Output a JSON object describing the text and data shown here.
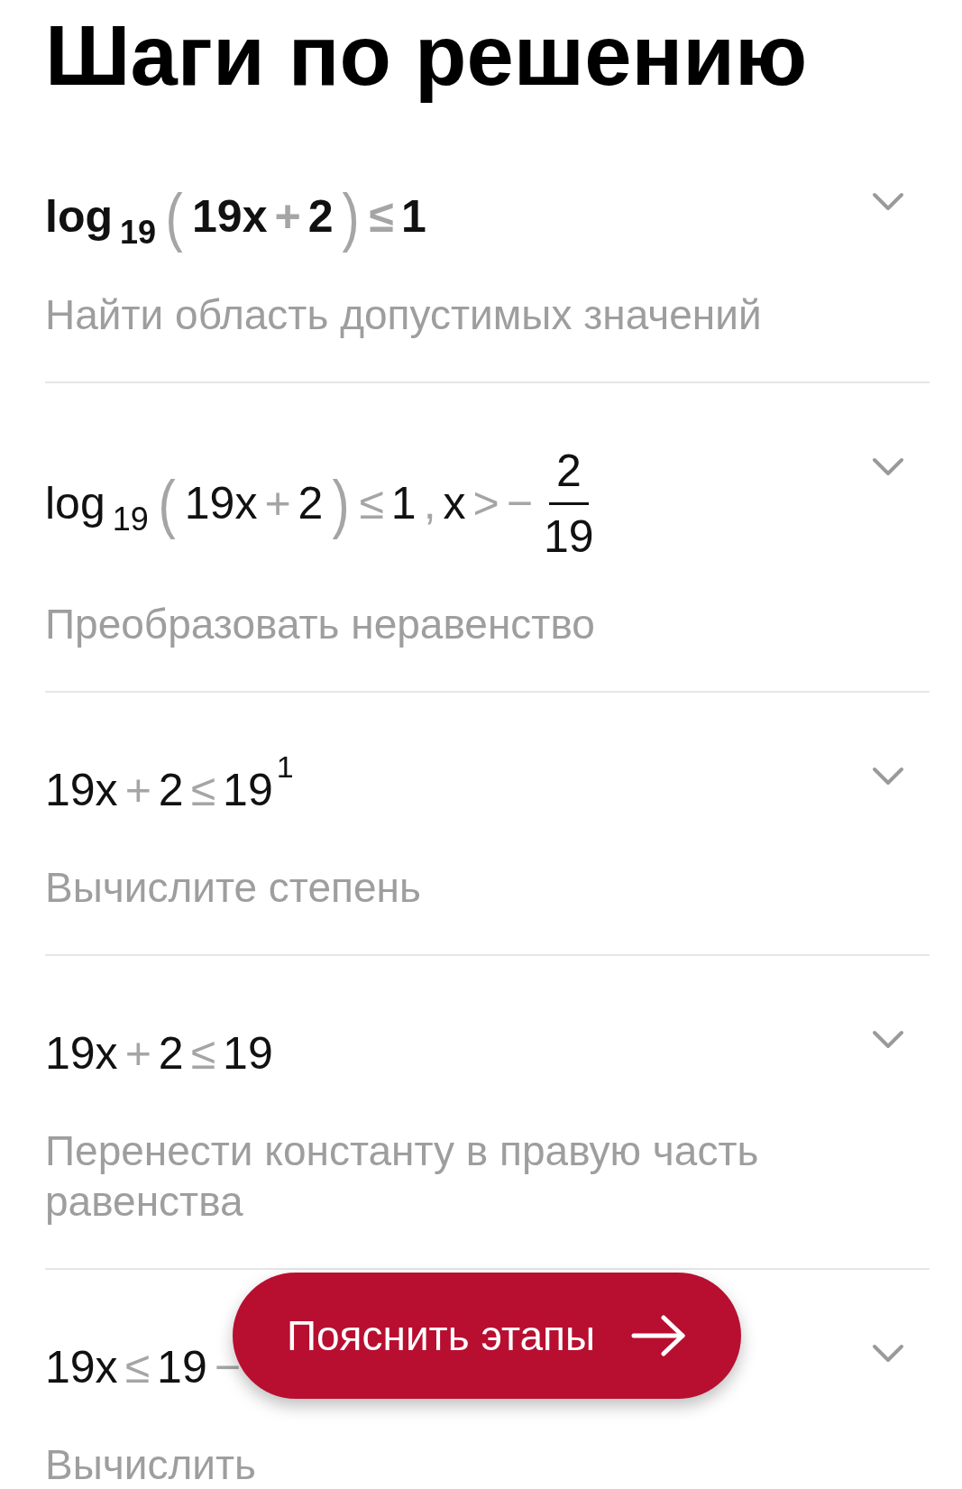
{
  "title": "Шаги по решению",
  "steps": [
    {
      "bold": true,
      "formula": [
        {
          "kind": "num",
          "text": "log"
        },
        {
          "kind": "sub",
          "text": "19"
        },
        {
          "kind": "paren",
          "text": "("
        },
        {
          "kind": "num",
          "text": "19x"
        },
        {
          "kind": "op",
          "text": "+"
        },
        {
          "kind": "num",
          "text": "2"
        },
        {
          "kind": "paren",
          "text": ")"
        },
        {
          "kind": "op",
          "text": "≤"
        },
        {
          "kind": "num",
          "text": "1"
        }
      ],
      "description": "Найти область допустимых значений"
    },
    {
      "bold": false,
      "formula": [
        {
          "kind": "num",
          "text": "log"
        },
        {
          "kind": "sub",
          "text": "19"
        },
        {
          "kind": "paren",
          "text": "("
        },
        {
          "kind": "num",
          "text": "19x"
        },
        {
          "kind": "op",
          "text": "+"
        },
        {
          "kind": "num",
          "text": "2"
        },
        {
          "kind": "paren",
          "text": ")"
        },
        {
          "kind": "op",
          "text": "≤"
        },
        {
          "kind": "num",
          "text": "1"
        },
        {
          "kind": "op",
          "text": ","
        },
        {
          "kind": "num",
          "text": "x"
        },
        {
          "kind": "op",
          "text": ">"
        },
        {
          "kind": "op",
          "text": "−"
        },
        {
          "kind": "frac",
          "num": "2",
          "den": "19"
        }
      ],
      "description": "Преобразовать неравенство"
    },
    {
      "bold": false,
      "formula": [
        {
          "kind": "num",
          "text": "19x"
        },
        {
          "kind": "op",
          "text": "+"
        },
        {
          "kind": "num",
          "text": "2"
        },
        {
          "kind": "op",
          "text": "≤"
        },
        {
          "kind": "num",
          "text": "19"
        },
        {
          "kind": "sup",
          "text": "1"
        }
      ],
      "description": "Вычислите степень"
    },
    {
      "bold": false,
      "formula": [
        {
          "kind": "num",
          "text": "19x"
        },
        {
          "kind": "op",
          "text": "+"
        },
        {
          "kind": "num",
          "text": "2"
        },
        {
          "kind": "op",
          "text": "≤"
        },
        {
          "kind": "num",
          "text": "19"
        }
      ],
      "description": "Перенести константу в правую часть равенства"
    },
    {
      "bold": false,
      "formula": [
        {
          "kind": "num",
          "text": "19x"
        },
        {
          "kind": "op",
          "text": "≤"
        },
        {
          "kind": "num",
          "text": "19"
        },
        {
          "kind": "op",
          "text": "−"
        }
      ],
      "description": "Вычислить"
    }
  ],
  "action_button": {
    "label": "Пояснить этапы"
  }
}
